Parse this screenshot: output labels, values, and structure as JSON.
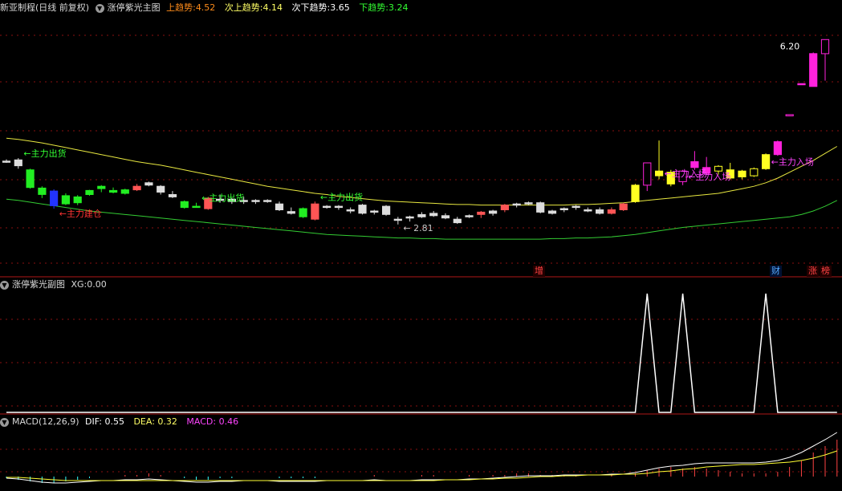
{
  "main_panel": {
    "title": "新亚制程(日线 前复权)",
    "indicator": "涨停紫光主图",
    "legend": [
      {
        "label": "上趋势:",
        "value": "4.52",
        "color": "#ff8c1a"
      },
      {
        "label": "次上趋势:",
        "value": "4.14",
        "color": "#ffff66"
      },
      {
        "label": "次下趋势:",
        "value": "3.65",
        "color": "#ffffff"
      },
      {
        "label": "下趋势:",
        "value": "3.24",
        "color": "#33ff33"
      }
    ],
    "badges": {
      "zeng": "增",
      "cai": "财",
      "zhang": "涨",
      "bang": "榜"
    }
  },
  "sub_panel": {
    "title": "涨停紫光副图",
    "legend_label": "XG:",
    "legend_value": "0.00"
  },
  "macd_panel": {
    "title": "MACD(12,26,9)",
    "dif_label": "DIF:",
    "dif_value": "0.55",
    "dea_label": "DEA:",
    "dea_value": "0.32",
    "macd_label": "MACD:",
    "macd_value": "0.46"
  },
  "chart_data": [
    {
      "type": "candlestick",
      "title": "新亚制程(日线 前复权)",
      "annotations": [
        {
          "text": "←主力出货",
          "color": "#33ff33",
          "at_index": 1
        },
        {
          "text": "←主力建仓",
          "color": "#ff3333",
          "at_index": 4
        },
        {
          "text": "←主力出货",
          "color": "#33ff33",
          "at_index": 16
        },
        {
          "text": "←主力出货",
          "color": "#33ff33",
          "at_index": 26
        },
        {
          "text": "← 2.81",
          "color": "#c8c8c8",
          "at_index": 33
        },
        {
          "text": "←主力入场",
          "color": "#ff44ff",
          "at_index": 55
        },
        {
          "text": "←主力入场",
          "color": "#ff44ff",
          "at_index": 57
        },
        {
          "text": "←主力入场",
          "color": "#ff44ff",
          "at_index": 64
        },
        {
          "text": "6.20",
          "color": "#ffffff",
          "at_index": 68
        }
      ],
      "price_range": [
        2.2,
        6.6
      ],
      "colors": {
        "green": "#22ee22",
        "blue": "#2233ff",
        "white": "#dddddd",
        "red": "#ff5555",
        "magenta": "#ff22dd",
        "yellow": "#ffff22"
      },
      "candles": [
        {
          "o": 4.13,
          "h": 4.16,
          "l": 4.1,
          "c": 4.12,
          "col": "white"
        },
        {
          "o": 4.15,
          "h": 4.18,
          "l": 4.0,
          "c": 4.05,
          "col": "white"
        },
        {
          "o": 3.68,
          "h": 4.0,
          "l": 3.66,
          "c": 3.98,
          "col": "green"
        },
        {
          "o": 3.56,
          "h": 3.7,
          "l": 3.5,
          "c": 3.67,
          "col": "green"
        },
        {
          "o": 3.62,
          "h": 3.65,
          "l": 3.32,
          "c": 3.37,
          "col": "blue"
        },
        {
          "o": 3.54,
          "h": 3.58,
          "l": 3.38,
          "c": 3.4,
          "col": "green"
        },
        {
          "o": 3.42,
          "h": 3.55,
          "l": 3.38,
          "c": 3.52,
          "col": "green"
        },
        {
          "o": 3.56,
          "h": 3.64,
          "l": 3.54,
          "c": 3.63,
          "col": "green"
        },
        {
          "o": 3.66,
          "h": 3.72,
          "l": 3.6,
          "c": 3.7,
          "col": "green"
        },
        {
          "o": 3.63,
          "h": 3.68,
          "l": 3.58,
          "c": 3.6,
          "col": "green"
        },
        {
          "o": 3.58,
          "h": 3.66,
          "l": 3.56,
          "c": 3.64,
          "col": "green"
        },
        {
          "o": 3.7,
          "h": 3.74,
          "l": 3.62,
          "c": 3.64,
          "col": "red"
        },
        {
          "o": 3.72,
          "h": 3.78,
          "l": 3.7,
          "c": 3.76,
          "col": "white"
        },
        {
          "o": 3.6,
          "h": 3.72,
          "l": 3.56,
          "c": 3.7,
          "col": "white"
        },
        {
          "o": 3.56,
          "h": 3.62,
          "l": 3.5,
          "c": 3.52,
          "col": "white"
        },
        {
          "o": 3.34,
          "h": 3.46,
          "l": 3.32,
          "c": 3.44,
          "col": "green"
        },
        {
          "o": 3.36,
          "h": 3.42,
          "l": 3.34,
          "c": 3.36,
          "col": "green"
        },
        {
          "o": 3.5,
          "h": 3.52,
          "l": 3.3,
          "c": 3.32,
          "col": "red"
        },
        {
          "o": 3.48,
          "h": 3.56,
          "l": 3.42,
          "c": 3.46,
          "col": "white"
        },
        {
          "o": 3.44,
          "h": 3.5,
          "l": 3.4,
          "c": 3.48,
          "col": "white"
        },
        {
          "o": 3.46,
          "h": 3.52,
          "l": 3.4,
          "c": 3.44,
          "col": "white"
        },
        {
          "o": 3.44,
          "h": 3.48,
          "l": 3.4,
          "c": 3.46,
          "col": "white"
        },
        {
          "o": 3.46,
          "h": 3.48,
          "l": 3.42,
          "c": 3.44,
          "col": "white"
        },
        {
          "o": 3.4,
          "h": 3.44,
          "l": 3.28,
          "c": 3.3,
          "col": "white"
        },
        {
          "o": 3.27,
          "h": 3.34,
          "l": 3.22,
          "c": 3.24,
          "col": "white"
        },
        {
          "o": 3.18,
          "h": 3.34,
          "l": 3.16,
          "c": 3.32,
          "col": "green"
        },
        {
          "o": 3.4,
          "h": 3.44,
          "l": 3.12,
          "c": 3.14,
          "col": "red"
        },
        {
          "o": 3.36,
          "h": 3.38,
          "l": 3.32,
          "c": 3.35,
          "col": "white"
        },
        {
          "o": 3.36,
          "h": 3.38,
          "l": 3.3,
          "c": 3.34,
          "col": "white"
        },
        {
          "o": 3.3,
          "h": 3.34,
          "l": 3.24,
          "c": 3.28,
          "col": "white"
        },
        {
          "o": 3.38,
          "h": 3.4,
          "l": 3.22,
          "c": 3.24,
          "col": "white"
        },
        {
          "o": 3.26,
          "h": 3.3,
          "l": 3.22,
          "c": 3.28,
          "col": "white"
        },
        {
          "o": 3.36,
          "h": 3.38,
          "l": 3.2,
          "c": 3.22,
          "col": "white"
        },
        {
          "o": 3.14,
          "h": 3.18,
          "l": 3.05,
          "c": 3.12,
          "col": "white"
        },
        {
          "o": 3.16,
          "h": 3.2,
          "l": 3.1,
          "c": 3.18,
          "col": "white"
        },
        {
          "o": 3.22,
          "h": 3.26,
          "l": 3.16,
          "c": 3.18,
          "col": "white"
        },
        {
          "o": 3.24,
          "h": 3.28,
          "l": 3.18,
          "c": 3.2,
          "col": "white"
        },
        {
          "o": 3.2,
          "h": 3.24,
          "l": 3.14,
          "c": 3.16,
          "col": "white"
        },
        {
          "o": 3.14,
          "h": 3.18,
          "l": 3.06,
          "c": 3.08,
          "col": "white"
        },
        {
          "o": 3.18,
          "h": 3.22,
          "l": 3.16,
          "c": 3.2,
          "col": "white"
        },
        {
          "o": 3.22,
          "h": 3.28,
          "l": 3.16,
          "c": 3.26,
          "col": "red"
        },
        {
          "o": 3.28,
          "h": 3.3,
          "l": 3.2,
          "c": 3.24,
          "col": "white"
        },
        {
          "o": 3.3,
          "h": 3.4,
          "l": 3.26,
          "c": 3.38,
          "col": "red"
        },
        {
          "o": 3.38,
          "h": 3.42,
          "l": 3.34,
          "c": 3.4,
          "col": "white"
        },
        {
          "o": 3.4,
          "h": 3.44,
          "l": 3.38,
          "c": 3.42,
          "col": "white"
        },
        {
          "o": 3.42,
          "h": 3.44,
          "l": 3.24,
          "c": 3.26,
          "col": "white"
        },
        {
          "o": 3.28,
          "h": 3.3,
          "l": 3.22,
          "c": 3.24,
          "col": "white"
        },
        {
          "o": 3.3,
          "h": 3.34,
          "l": 3.26,
          "c": 3.32,
          "col": "white"
        },
        {
          "o": 3.34,
          "h": 3.38,
          "l": 3.3,
          "c": 3.36,
          "col": "white"
        },
        {
          "o": 3.3,
          "h": 3.34,
          "l": 3.26,
          "c": 3.28,
          "col": "white"
        },
        {
          "o": 3.3,
          "h": 3.34,
          "l": 3.22,
          "c": 3.24,
          "col": "white"
        },
        {
          "o": 3.24,
          "h": 3.34,
          "l": 3.22,
          "c": 3.3,
          "col": "red"
        },
        {
          "o": 3.3,
          "h": 3.42,
          "l": 3.28,
          "c": 3.4,
          "col": "red"
        },
        {
          "o": 3.44,
          "h": 3.74,
          "l": 3.42,
          "c": 3.72,
          "col": "yellow"
        },
        {
          "o": 3.72,
          "h": 4.1,
          "l": 3.62,
          "c": 4.1,
          "col": "magenta"
        },
        {
          "o": 3.88,
          "h": 4.48,
          "l": 3.82,
          "c": 3.96,
          "col": "yellow"
        },
        {
          "o": 3.74,
          "h": 3.98,
          "l": 3.7,
          "c": 3.94,
          "col": "yellow"
        },
        {
          "o": 3.78,
          "h": 3.98,
          "l": 3.72,
          "c": 3.96,
          "col": "magenta"
        },
        {
          "o": 4.12,
          "h": 4.3,
          "l": 3.98,
          "c": 4.02,
          "col": "magenta"
        },
        {
          "o": 4.02,
          "h": 4.2,
          "l": 3.9,
          "c": 3.92,
          "col": "magenta"
        },
        {
          "o": 3.96,
          "h": 4.06,
          "l": 3.9,
          "c": 4.04,
          "col": "yellow"
        },
        {
          "o": 3.98,
          "h": 4.1,
          "l": 3.82,
          "c": 3.84,
          "col": "yellow"
        },
        {
          "o": 3.86,
          "h": 3.98,
          "l": 3.82,
          "c": 3.96,
          "col": "yellow"
        },
        {
          "o": 3.88,
          "h": 4.02,
          "l": 3.86,
          "c": 4.0,
          "col": "yellow"
        },
        {
          "o": 4.0,
          "h": 4.26,
          "l": 3.98,
          "c": 4.24,
          "col": "yellow"
        },
        {
          "o": 4.24,
          "h": 4.48,
          "l": 4.22,
          "c": 4.46,
          "col": "magenta"
        },
        {
          "o": 4.9,
          "h": 4.92,
          "l": 4.9,
          "c": 4.92,
          "col": "magenta"
        },
        {
          "o": 5.43,
          "h": 5.45,
          "l": 5.43,
          "c": 5.45,
          "col": "magenta"
        },
        {
          "o": 5.4,
          "h": 5.98,
          "l": 5.4,
          "c": 5.96,
          "col": "magenta"
        },
        {
          "o": 5.96,
          "h": 6.2,
          "l": 5.5,
          "c": 6.2,
          "col": "magenta"
        }
      ],
      "upper_band": [
        4.52,
        4.5,
        4.47,
        4.44,
        4.4,
        4.36,
        4.32,
        4.28,
        4.24,
        4.2,
        4.16,
        4.12,
        4.09,
        4.06,
        4.02,
        3.98,
        3.94,
        3.9,
        3.86,
        3.82,
        3.78,
        3.74,
        3.7,
        3.67,
        3.64,
        3.61,
        3.58,
        3.56,
        3.53,
        3.51,
        3.49,
        3.47,
        3.45,
        3.44,
        3.43,
        3.42,
        3.41,
        3.4,
        3.39,
        3.39,
        3.38,
        3.38,
        3.38,
        3.38,
        3.38,
        3.38,
        3.38,
        3.38,
        3.39,
        3.39,
        3.4,
        3.41,
        3.42,
        3.44,
        3.46,
        3.48,
        3.5,
        3.52,
        3.54,
        3.56,
        3.58,
        3.62,
        3.66,
        3.7,
        3.76,
        3.84,
        3.94,
        4.04,
        4.14,
        4.26,
        4.38
      ],
      "lower_band": [
        3.48,
        3.46,
        3.43,
        3.4,
        3.37,
        3.34,
        3.31,
        3.28,
        3.26,
        3.24,
        3.22,
        3.2,
        3.18,
        3.16,
        3.14,
        3.12,
        3.1,
        3.08,
        3.06,
        3.04,
        3.02,
        3.0,
        2.98,
        2.96,
        2.94,
        2.92,
        2.9,
        2.88,
        2.87,
        2.86,
        2.85,
        2.84,
        2.83,
        2.82,
        2.82,
        2.81,
        2.81,
        2.8,
        2.8,
        2.8,
        2.8,
        2.8,
        2.8,
        2.8,
        2.8,
        2.8,
        2.81,
        2.81,
        2.82,
        2.82,
        2.83,
        2.84,
        2.86,
        2.88,
        2.91,
        2.94,
        2.97,
        3.0,
        3.02,
        3.04,
        3.06,
        3.08,
        3.1,
        3.12,
        3.14,
        3.16,
        3.18,
        3.22,
        3.28,
        3.36,
        3.46
      ]
    },
    {
      "type": "line",
      "title": "涨停紫光副图",
      "series": [
        {
          "name": "XG",
          "color": "#ffffff",
          "values": [
            0,
            0,
            0,
            0,
            0,
            0,
            0,
            0,
            0,
            0,
            0,
            0,
            0,
            0,
            0,
            0,
            0,
            0,
            0,
            0,
            0,
            0,
            0,
            0,
            0,
            0,
            0,
            0,
            0,
            0,
            0,
            0,
            0,
            0,
            0,
            0,
            0,
            0,
            0,
            0,
            0,
            0,
            0,
            0,
            0,
            0,
            0,
            0,
            0,
            0,
            0,
            0,
            0,
            0,
            1,
            0,
            0,
            1,
            0,
            0,
            0,
            0,
            0,
            0,
            1,
            0,
            0,
            0,
            0,
            0,
            0
          ]
        }
      ]
    },
    {
      "type": "line",
      "title": "MACD(12,26,9)",
      "series": [
        {
          "name": "DIF",
          "color": "#ffffff",
          "values": [
            -0.02,
            -0.03,
            -0.05,
            -0.07,
            -0.08,
            -0.08,
            -0.07,
            -0.06,
            -0.05,
            -0.05,
            -0.04,
            -0.04,
            -0.03,
            -0.04,
            -0.05,
            -0.06,
            -0.07,
            -0.07,
            -0.06,
            -0.06,
            -0.05,
            -0.05,
            -0.05,
            -0.06,
            -0.06,
            -0.06,
            -0.06,
            -0.05,
            -0.05,
            -0.05,
            -0.05,
            -0.04,
            -0.05,
            -0.05,
            -0.05,
            -0.04,
            -0.04,
            -0.04,
            -0.04,
            -0.03,
            -0.03,
            -0.02,
            -0.01,
            0.0,
            0.01,
            0.01,
            0.01,
            0.02,
            0.02,
            0.02,
            0.02,
            0.03,
            0.03,
            0.05,
            0.08,
            0.11,
            0.13,
            0.14,
            0.16,
            0.17,
            0.17,
            0.17,
            0.17,
            0.17,
            0.18,
            0.2,
            0.24,
            0.3,
            0.38,
            0.46,
            0.55
          ]
        },
        {
          "name": "DEA",
          "color": "#ffff33",
          "values": [
            -0.01,
            -0.01,
            -0.02,
            -0.03,
            -0.04,
            -0.05,
            -0.05,
            -0.05,
            -0.05,
            -0.05,
            -0.05,
            -0.05,
            -0.05,
            -0.05,
            -0.05,
            -0.05,
            -0.05,
            -0.05,
            -0.05,
            -0.05,
            -0.05,
            -0.05,
            -0.05,
            -0.05,
            -0.05,
            -0.05,
            -0.05,
            -0.05,
            -0.05,
            -0.05,
            -0.05,
            -0.05,
            -0.05,
            -0.05,
            -0.05,
            -0.05,
            -0.05,
            -0.04,
            -0.04,
            -0.04,
            -0.03,
            -0.03,
            -0.02,
            -0.02,
            -0.01,
            0.0,
            0.0,
            0.01,
            0.01,
            0.02,
            0.02,
            0.02,
            0.03,
            0.03,
            0.04,
            0.06,
            0.07,
            0.09,
            0.1,
            0.12,
            0.13,
            0.14,
            0.15,
            0.15,
            0.16,
            0.17,
            0.18,
            0.2,
            0.23,
            0.27,
            0.32
          ]
        },
        {
          "name": "MACD",
          "color": "#ff44ff",
          "values": [
            -0.02,
            -0.04,
            -0.06,
            -0.08,
            -0.08,
            -0.06,
            -0.04,
            -0.02,
            0.0,
            0.0,
            0.02,
            0.02,
            0.04,
            0.02,
            0.0,
            -0.02,
            -0.04,
            -0.04,
            -0.02,
            -0.02,
            0.0,
            0.0,
            0.0,
            -0.02,
            -0.02,
            -0.02,
            -0.02,
            0.0,
            0.0,
            0.0,
            0.0,
            0.02,
            0.0,
            0.0,
            0.0,
            0.02,
            0.02,
            0.0,
            0.0,
            0.02,
            0.0,
            0.02,
            0.02,
            0.04,
            0.04,
            0.02,
            0.02,
            0.02,
            0.02,
            0.0,
            0.0,
            0.02,
            0.0,
            0.04,
            0.08,
            0.1,
            0.12,
            0.1,
            0.12,
            0.1,
            0.08,
            0.06,
            0.04,
            0.04,
            0.04,
            0.06,
            0.12,
            0.2,
            0.3,
            0.38,
            0.46
          ]
        }
      ]
    }
  ]
}
